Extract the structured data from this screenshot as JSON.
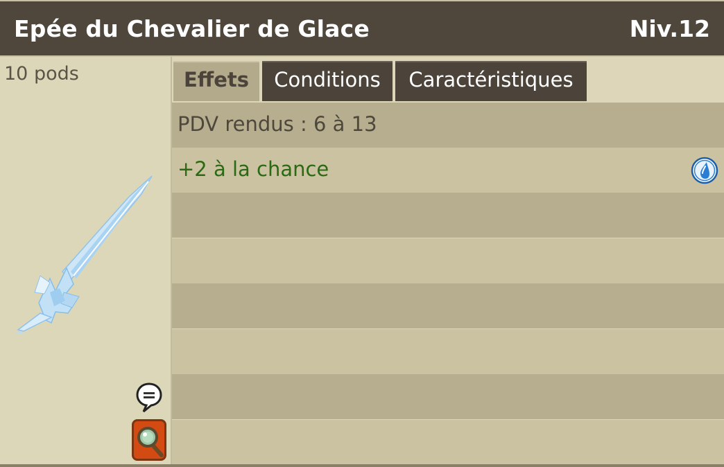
{
  "header": {
    "item_name": "Epée du Chevalier de Glace",
    "level": "Niv.12"
  },
  "item": {
    "weight": "10 pods",
    "image_icon": "ice-sword-icon"
  },
  "tabs": [
    {
      "label": "Effets",
      "active": true
    },
    {
      "label": "Conditions",
      "active": false
    },
    {
      "label": "Caractéristiques",
      "active": false
    }
  ],
  "effects": {
    "rows": [
      {
        "text": "PDV rendus : 6 à 13",
        "kind": "neutral"
      },
      {
        "text": "+2 à la chance",
        "kind": "bonus",
        "icon": "water-element-icon"
      },
      {
        "text": ""
      },
      {
        "text": ""
      },
      {
        "text": ""
      },
      {
        "text": ""
      },
      {
        "text": ""
      },
      {
        "text": ""
      }
    ]
  },
  "actions": {
    "chat_icon": "speech-bubble-icon",
    "inspect_icon": "magnifier-icon"
  },
  "colors": {
    "header_bg": "#4f473c",
    "panel_bg": "#ddd6b8",
    "row_dark": "#b7ae8f",
    "row_light": "#cbc2a1",
    "bonus_text": "#2a6a12",
    "water_element": "#2a7fd4",
    "inspect_button": "#d34b12"
  }
}
